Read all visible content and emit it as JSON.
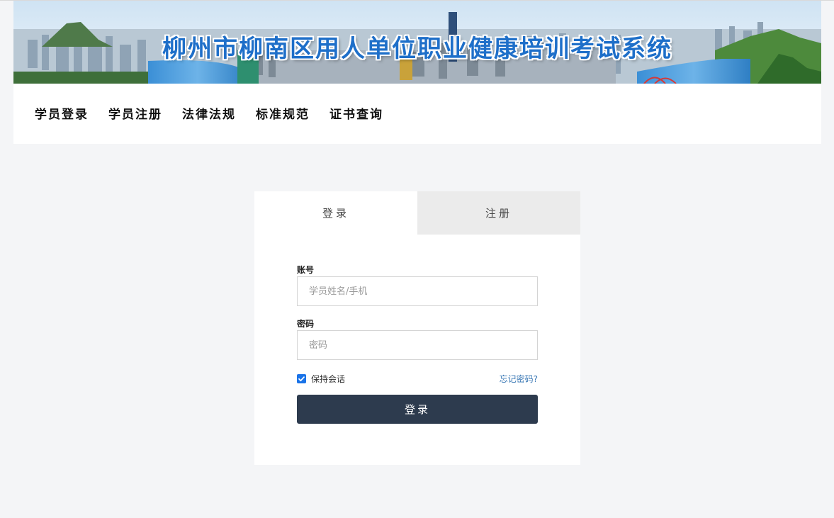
{
  "banner": {
    "title": "柳州市柳南区用人单位职业健康培训考试系统"
  },
  "nav": {
    "items": [
      "学员登录",
      "学员注册",
      "法律法规",
      "标准规范",
      "证书查询"
    ]
  },
  "tabs": {
    "login": "登录",
    "register": "注册"
  },
  "form": {
    "account_label": "账号",
    "account_placeholder": "学员姓名/手机",
    "password_label": "密码",
    "password_placeholder": "密码",
    "remember_label": "保持会话",
    "remember_checked": true,
    "forgot_label": "忘记密码?",
    "submit_label": "登录"
  },
  "colors": {
    "accent": "#1a73e8",
    "button": "#2d3b4e",
    "link": "#3a78b5",
    "title": "#1e6fc9"
  }
}
